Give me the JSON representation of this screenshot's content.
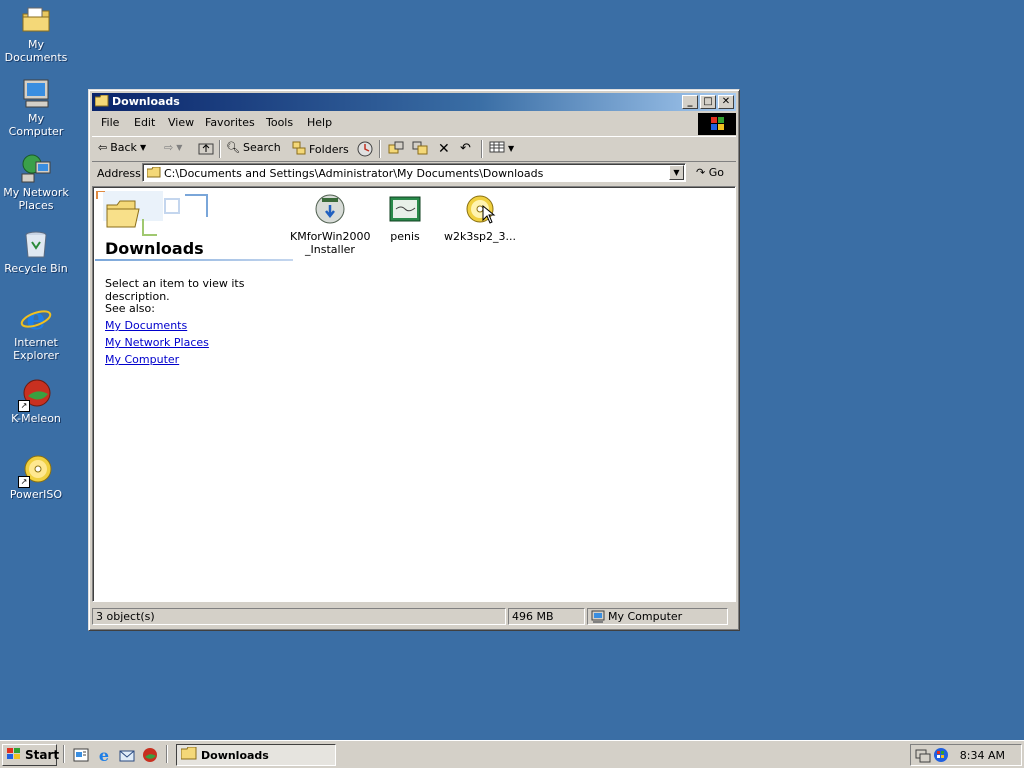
{
  "desktop": {
    "icons": [
      {
        "label": "My Documents"
      },
      {
        "label": "My Computer"
      },
      {
        "label": "My Network Places"
      },
      {
        "label": "Recycle Bin"
      },
      {
        "label": "Internet Explorer"
      },
      {
        "label": "K-Meleon"
      },
      {
        "label": "PowerISO"
      }
    ]
  },
  "window": {
    "title": "Downloads",
    "controls": {
      "minimize": "_",
      "maximize": "□",
      "close": "✕"
    },
    "menu": [
      "File",
      "Edit",
      "View",
      "Favorites",
      "Tools",
      "Help"
    ],
    "toolbar": {
      "back": "Back",
      "search": "Search",
      "folders": "Folders"
    },
    "address": {
      "label": "Address",
      "value": "C:\\Documents and Settings\\Administrator\\My Documents\\Downloads",
      "go": "Go"
    },
    "left_pane": {
      "title": "Downloads",
      "description": "Select an item to view its description.",
      "see_also": "See also:",
      "links": [
        "My Documents",
        "My Network Places",
        "My Computer"
      ]
    },
    "files": [
      {
        "label": "KMforWin2000_Installer",
        "line1": "KMforWin2000",
        "line2": "_Installer"
      },
      {
        "label": "penis"
      },
      {
        "label": "w2k3sp2_3..."
      }
    ],
    "status": {
      "objects": "3 object(s)",
      "size": "496 MB",
      "zone": "My Computer"
    }
  },
  "taskbar": {
    "start": "Start",
    "task": "Downloads",
    "clock": "8:34 AM"
  },
  "colors": {
    "desktop": "#3a6ea5",
    "titlebar_start": "#0a246a",
    "titlebar_end": "#a6caf0",
    "link": "#0000cc"
  }
}
